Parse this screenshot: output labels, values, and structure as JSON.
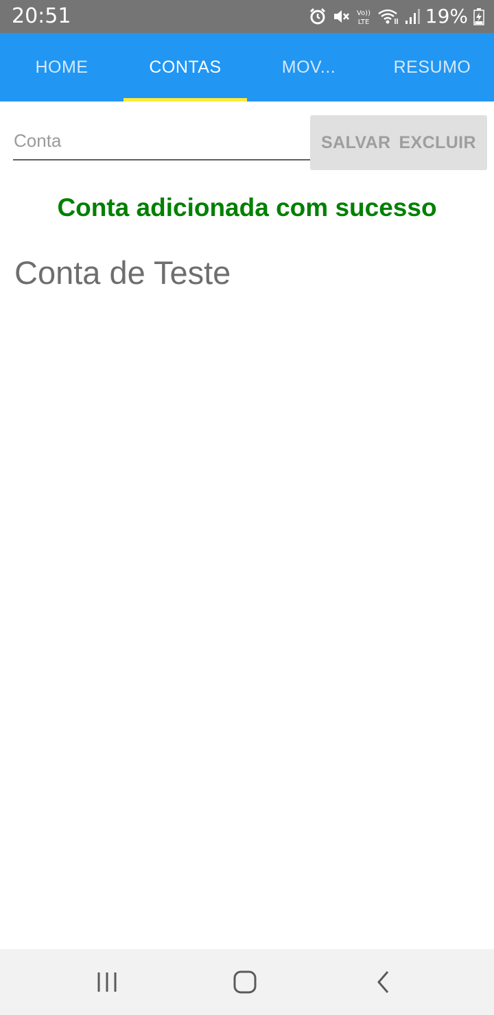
{
  "status_bar": {
    "time": "20:51",
    "battery_percent": "19%",
    "icons": [
      "alarm-icon",
      "mute-icon",
      "volte-icon",
      "wifi-icon",
      "signal-icon",
      "battery-charging-icon"
    ]
  },
  "tabs": [
    {
      "label": "HOME",
      "active": false
    },
    {
      "label": "CONTAS",
      "active": true
    },
    {
      "label": "MOV...",
      "active": false
    },
    {
      "label": "RESUMO",
      "active": false
    }
  ],
  "form": {
    "account_placeholder": "Conta",
    "account_value": "",
    "save_label": "SALVAR",
    "delete_label": "EXCLUIR"
  },
  "message": "Conta adicionada com sucesso",
  "accounts": [
    "Conta de Teste"
  ],
  "colors": {
    "tabbar": "#2196F3",
    "indicator": "#FFEB3B",
    "success": "#008000"
  },
  "navbar": {
    "icons": [
      "recent-apps-icon",
      "home-icon",
      "back-icon"
    ]
  }
}
